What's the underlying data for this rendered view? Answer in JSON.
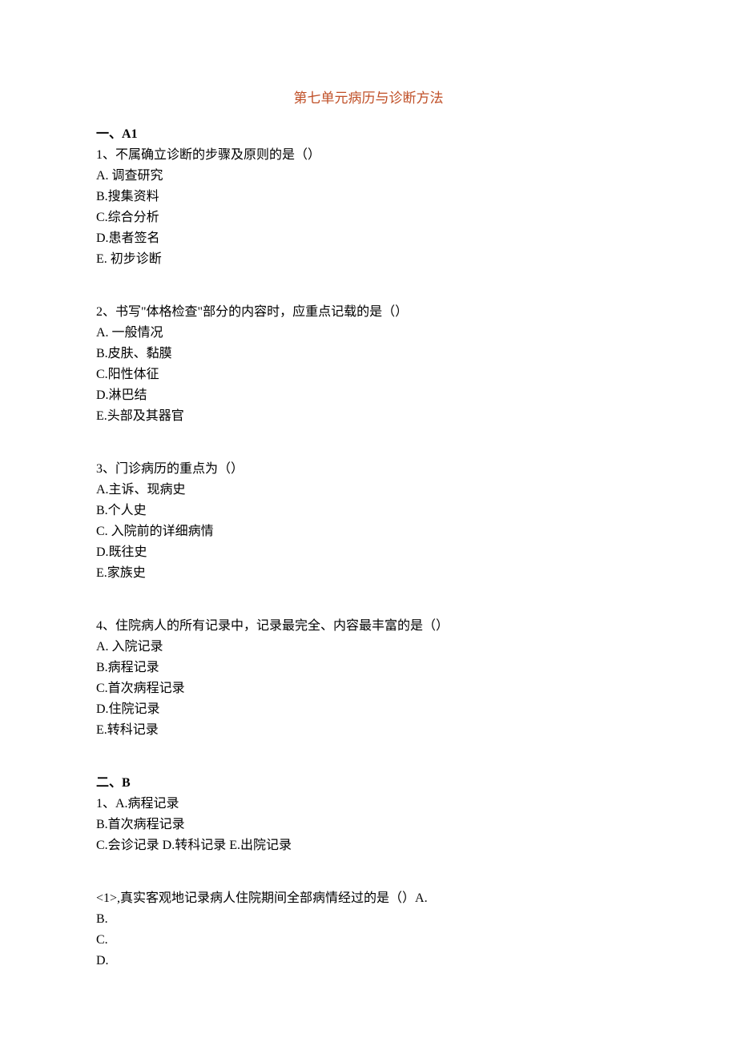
{
  "title": "第七单元病历与诊断方法",
  "sectionA": {
    "header_num": "一、",
    "header_label": "A1",
    "q1": {
      "stem": "1、不属确立诊断的步骤及原则的是（）",
      "A": "A. 调查研究",
      "B": "B.搜集资料",
      "C": "C.综合分析",
      "D": "D.患者签名",
      "E": "E. 初步诊断"
    },
    "q2": {
      "stem": "2、书写\"体格检查\"部分的内容时，应重点记载的是（）",
      "A": "A. 一般情况",
      "B": "B.皮肤、黏膜",
      "C": "C.阳性体征",
      "D": "D.淋巴结",
      "E": "E.头部及其器官"
    },
    "q3": {
      "stem": "3、门诊病历的重点为（）",
      "A": "A.主诉、现病史",
      "B": "B.个人史",
      "C": "C. 入院前的详细病情",
      "D": "D.既往史",
      "E": "E.家族史"
    },
    "q4": {
      "stem": "4、住院病人的所有记录中，记录最完全、内容最丰富的是（）",
      "A": "A. 入院记录",
      "B": "B.病程记录",
      "C": "C.首次病程记录",
      "D": "D.住院记录",
      "E": "E.转科记录"
    }
  },
  "sectionB": {
    "header_num": "二、",
    "header_label": "B",
    "q1": {
      "line1": "1、A.病程记录",
      "B": "B.首次病程记录",
      "CDE": "C.会诊记录 D.转科记录 E.出院记录"
    },
    "sub1": {
      "stem": "<1>,真实客观地记录病人住院期间全部病情经过的是（）A.",
      "B": "B.",
      "C": "C.",
      "D": "D."
    }
  }
}
